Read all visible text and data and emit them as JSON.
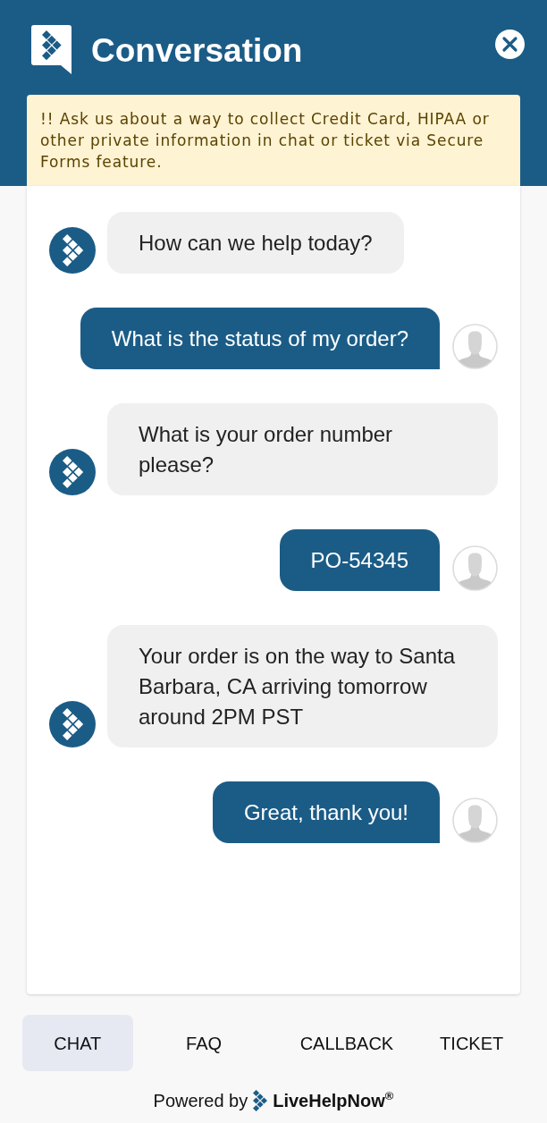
{
  "header": {
    "title": "Conversation"
  },
  "notice": {
    "text": "!! Ask us about a way to collect Credit Card, HIPAA or other private information in chat or ticket via Secure Forms feature."
  },
  "messages": [
    {
      "kind": "agent",
      "text": "How can we help today?"
    },
    {
      "kind": "visitor",
      "text": "What is the status of my order?"
    },
    {
      "kind": "agent",
      "text": "What is your order number please?"
    },
    {
      "kind": "visitor",
      "text": "PO-54345"
    },
    {
      "kind": "agent",
      "text": "Your order is on the way to Santa Barbara, CA arriving tomorrow around 2PM PST"
    },
    {
      "kind": "visitor",
      "text": "Great, thank you!"
    }
  ],
  "tabs": [
    {
      "label": "CHAT",
      "selected": true
    },
    {
      "label": "FAQ",
      "selected": false
    },
    {
      "label": "CALLBACK",
      "selected": false
    },
    {
      "label": "TICKET",
      "selected": false
    }
  ],
  "footer": {
    "prefix": "Powered by",
    "brand": "LiveHelpNow$^{®}$"
  }
}
